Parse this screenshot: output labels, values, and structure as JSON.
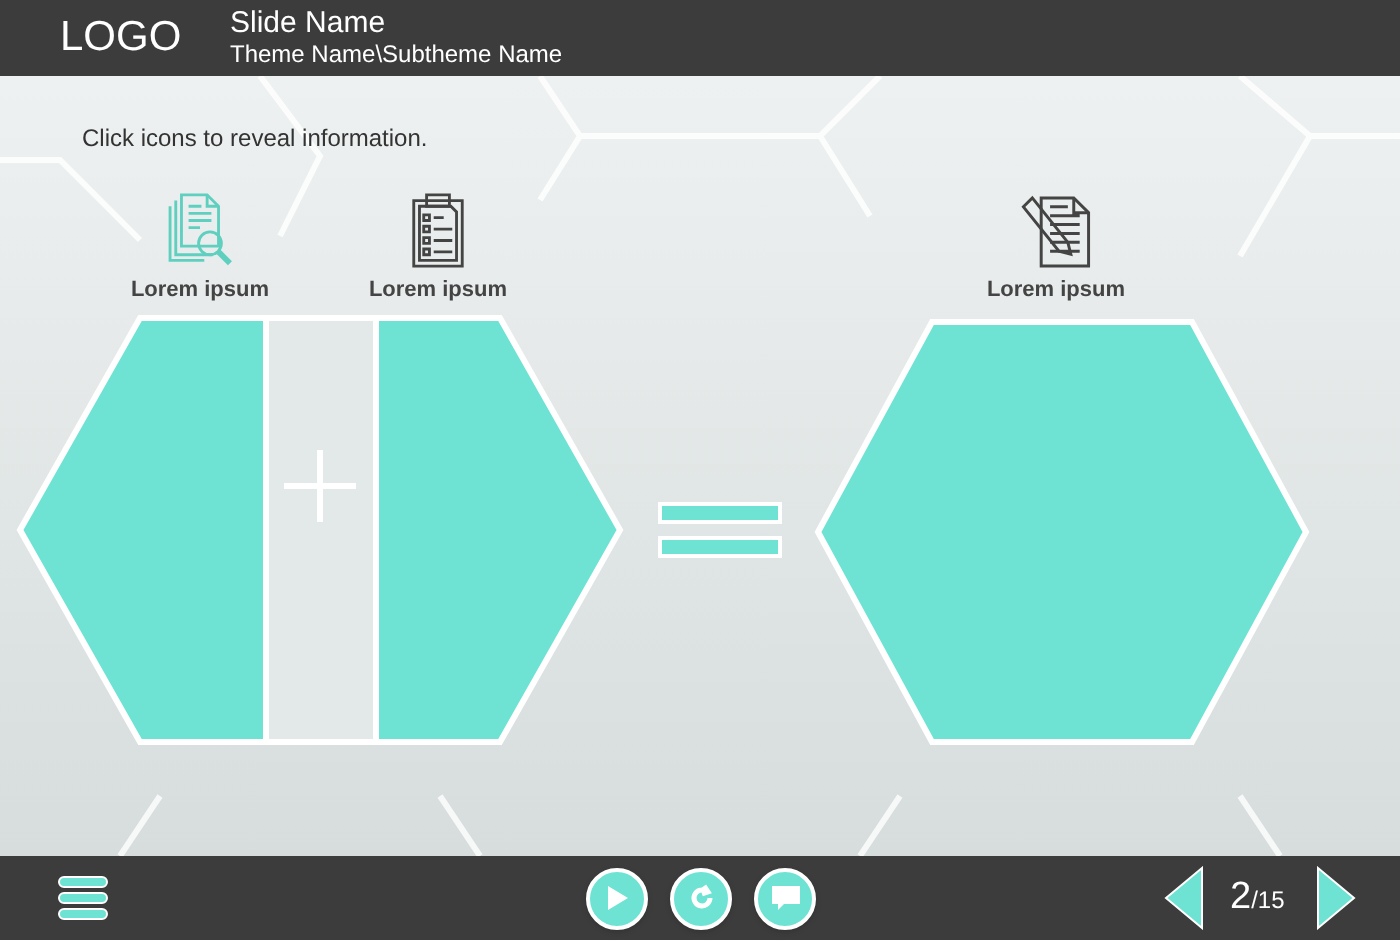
{
  "header": {
    "logo": "LOGO",
    "slide_name": "Slide Name",
    "theme_path": "Theme Name\\Subtheme Name"
  },
  "instruction": "Click icons to reveal information.",
  "items": [
    {
      "kind": "research",
      "label": "Lorem ipsum",
      "visited": true
    },
    {
      "kind": "checklist",
      "label": "Lorem ipsum",
      "visited": false
    },
    {
      "kind": "writing",
      "label": "Lorem ipsum",
      "visited": false
    }
  ],
  "pager": {
    "current": "2",
    "total": "/15"
  }
}
